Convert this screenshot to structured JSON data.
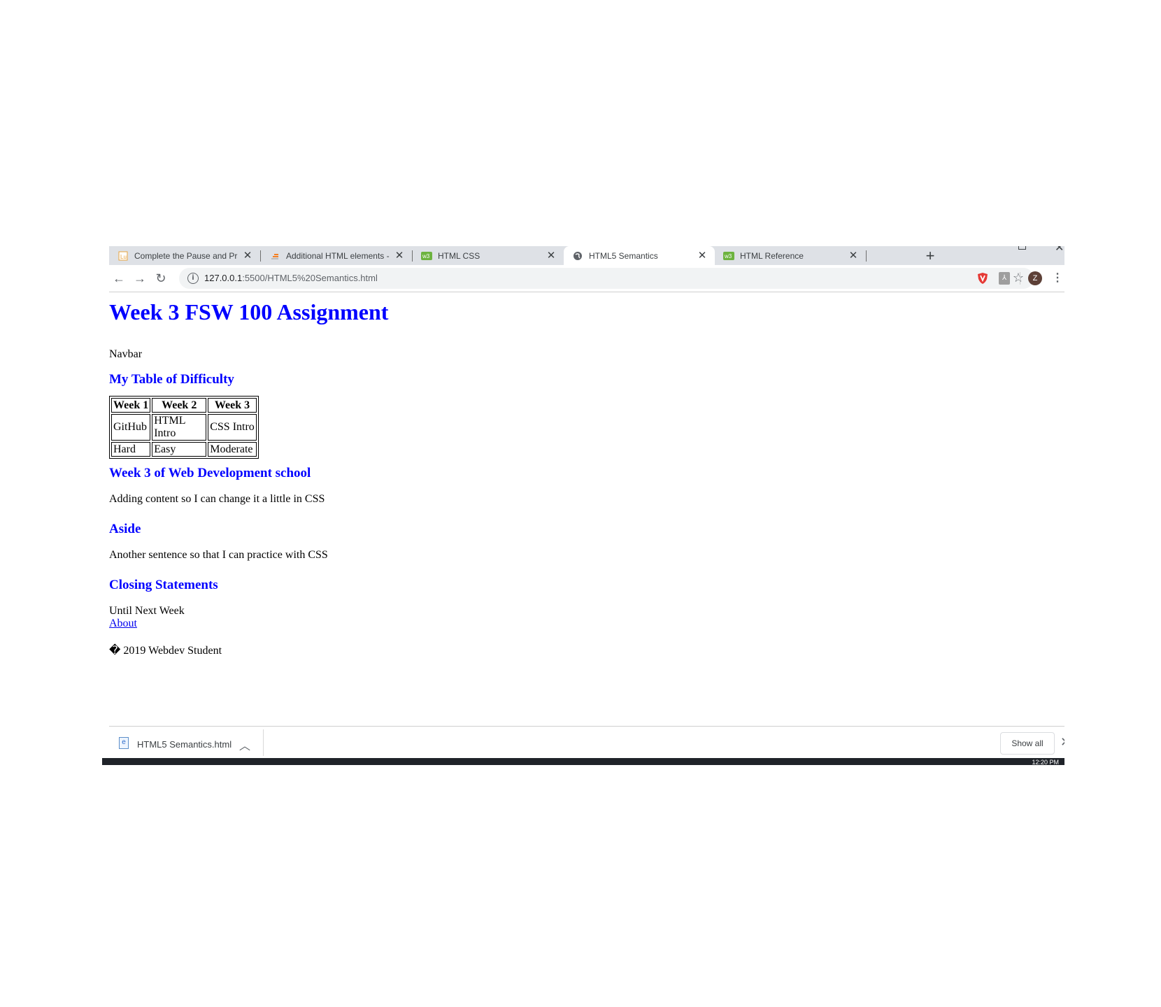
{
  "browser": {
    "tabs": [
      {
        "title": "Complete the Pause and Practi",
        "favicon": "lms-favicon",
        "active": false
      },
      {
        "title": "Additional HTML elements - Sc",
        "favicon": "stackoverflow-favicon",
        "active": false
      },
      {
        "title": "HTML CSS",
        "favicon": "w3schools-favicon",
        "active": false
      },
      {
        "title": "HTML5 Semantics",
        "favicon": "globe-icon",
        "active": true
      },
      {
        "title": "HTML Reference",
        "favicon": "w3schools-favicon",
        "active": false
      }
    ],
    "new_tab_label": "+",
    "url_host": "127.0.0.1",
    "url_path": ":5500/HTML5%20Semantics.html",
    "avatar_letter": "Z"
  },
  "page": {
    "title": "Week 3 FSW 100 Assignment",
    "navbar_text": "Navbar",
    "table_heading": "My Table of Difficulty",
    "table": {
      "headers": [
        "Week 1",
        "Week 2",
        "Week 3"
      ],
      "rows": [
        [
          "GitHub",
          "HTML Intro",
          "CSS Intro"
        ],
        [
          "Hard",
          "Easy",
          "Moderate"
        ]
      ]
    },
    "section_heading": "Week 3 of Web Development school",
    "section_text": "Adding content so I can change it a little in CSS",
    "aside_heading": "Aside",
    "aside_text": "Another sentence so that I can practice with CSS",
    "closing_heading": "Closing Statements",
    "closing_text": "Until Next Week",
    "about_link": "About",
    "copyright": "� 2019 Webdev Student"
  },
  "download_bar": {
    "file_name": "HTML5 Semantics.html",
    "show_all_label": "Show all"
  },
  "taskbar": {
    "clock": "12:20 PM"
  },
  "colors": {
    "heading": "#0000ff",
    "link": "#0000ee",
    "tabstrip": "#dee1e6",
    "omnibox": "#f1f3f4"
  }
}
